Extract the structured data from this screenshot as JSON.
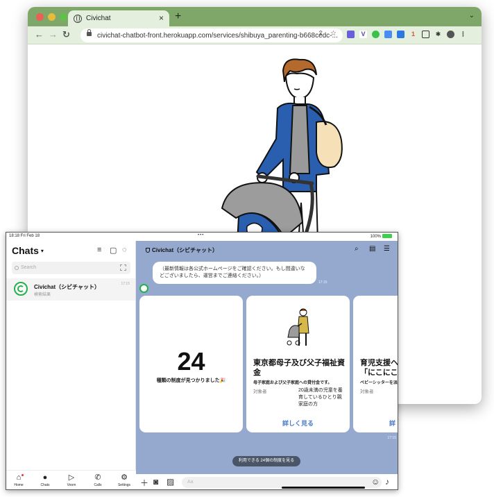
{
  "browser": {
    "tab_title": "Civichat",
    "tab_close": "×",
    "new_tab": "+",
    "url": "civichat-chatbot-front.herokuapp.com/services/shibuya_parenting-b668cedc-...",
    "ext_badge": "1",
    "accent": "#7fa76a"
  },
  "ipad": {
    "status_time": "18:18  Fri Feb 18",
    "status_dots": "•••",
    "status_right": "100%",
    "sidebar": {
      "title": "Chats",
      "search_placeholder": "Search",
      "chat_name": "Civichat（シビチャット）",
      "chat_sub": "検索結果",
      "chat_time": "17:15",
      "nav": [
        {
          "label": "Home",
          "icon": "home-icon"
        },
        {
          "label": "Chats",
          "icon": "chat-bubble-icon"
        },
        {
          "label": "Voom",
          "icon": "play-icon"
        },
        {
          "label": "Calls",
          "icon": "phone-icon"
        },
        {
          "label": "Settings",
          "icon": "gear-icon"
        }
      ]
    },
    "chat": {
      "title": "Civichat（シビチャット）",
      "notice": "（最新情報は各公式ホームページをご確認ください。もし間違いなどございましたら、運営までご連絡ください。）",
      "notice_time": "17:15",
      "card1": {
        "number": "24",
        "subtitle": "種類の制度が見つかりました🎉"
      },
      "card2": {
        "title": "東京都母子及び父子福祉資金",
        "desc": "母子家庭および父子家庭への貸付金です。",
        "label": "対象者",
        "value": "20歳未満の児童を養育しているひとり親家庭の方",
        "link": "詳しく見る"
      },
      "card3": {
        "title": "育児支援ヘル\n「にこにこす",
        "desc": "ベビーシッターを派",
        "label": "対象者",
        "link": "詳"
      },
      "cards_time": "17:15",
      "quick_reply": "利用できる 24個の制度を見る",
      "input_placeholder": "Aa",
      "bg_color": "#95a9cf",
      "link_color": "#4a78c8"
    }
  }
}
